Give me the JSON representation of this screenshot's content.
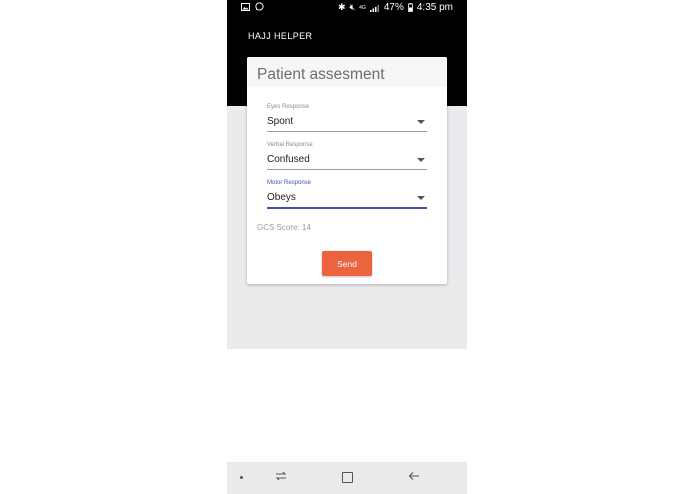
{
  "status_bar": {
    "battery": "47%",
    "time": "4:35 pm",
    "network": "4G"
  },
  "app": {
    "title": "HAJJ HELPER"
  },
  "card": {
    "title": "Patient assesment"
  },
  "fields": {
    "eyes": {
      "label": "Eyes Response",
      "value": "Spont"
    },
    "verbal": {
      "label": "Verbal Response",
      "value": "Confused"
    },
    "motor": {
      "label": "Motor Response",
      "value": "Obeys"
    }
  },
  "gcs_score": "GCS Score: 14",
  "send_label": "Send",
  "colors": {
    "accent": "#3f51b5",
    "button": "#ec6340",
    "appbar": "#000000",
    "background": "#ebebee"
  },
  "icons": [
    "image-icon",
    "whatsapp-icon",
    "bluetooth-icon",
    "mute-icon",
    "signal-icon",
    "battery-icon",
    "recent-apps-icon",
    "home-icon",
    "back-icon"
  ]
}
